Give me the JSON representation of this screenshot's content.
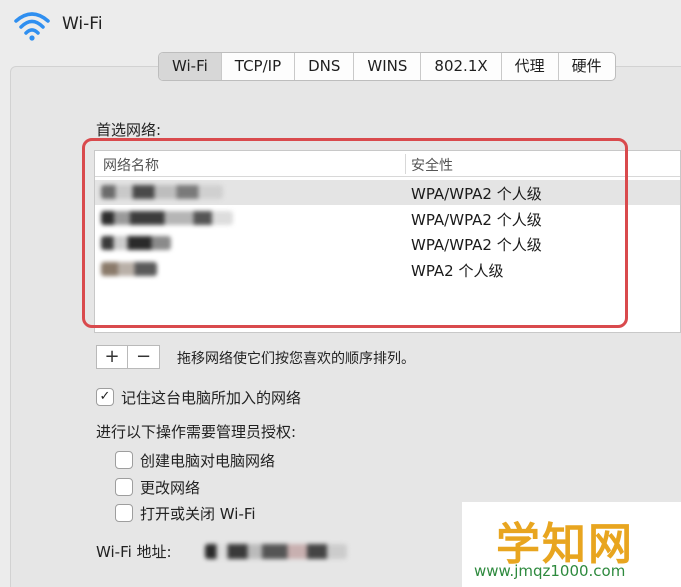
{
  "header": {
    "title": "Wi-Fi",
    "icon": "wifi-icon"
  },
  "tabs": [
    {
      "label": "Wi-Fi",
      "active": true
    },
    {
      "label": "TCP/IP",
      "active": false
    },
    {
      "label": "DNS",
      "active": false
    },
    {
      "label": "WINS",
      "active": false
    },
    {
      "label": "802.1X",
      "active": false
    },
    {
      "label": "代理",
      "active": false
    },
    {
      "label": "硬件",
      "active": false
    }
  ],
  "preferred": {
    "label": "首选网络:",
    "columns": {
      "name": "网络名称",
      "security": "安全性"
    },
    "rows": [
      {
        "security": "WPA/WPA2 个人级",
        "selected": true
      },
      {
        "security": "WPA/WPA2 个人级",
        "selected": false
      },
      {
        "security": "WPA/WPA2 个人级",
        "selected": false
      },
      {
        "security": "WPA2 个人级",
        "selected": false
      }
    ]
  },
  "list_controls": {
    "add": "+",
    "remove": "−",
    "hint": "拖移网络使它们按您喜欢的顺序排列。"
  },
  "remember": {
    "label": "记住这台电脑所加入的网络",
    "checked": true,
    "check_mark": "✓"
  },
  "admin": {
    "label": "进行以下操作需要管理员授权:",
    "options": [
      {
        "label": "创建电脑对电脑网络",
        "checked": false
      },
      {
        "label": "更改网络",
        "checked": false
      },
      {
        "label": "打开或关闭 Wi-Fi",
        "checked": false
      }
    ]
  },
  "wifi_address": {
    "label": "Wi-Fi 地址:"
  },
  "watermark": {
    "title": "学知网",
    "url": "www.jmqz1000.com"
  },
  "colors": {
    "highlight": "#d94a4d",
    "wifi_icon": "#2f8ff0",
    "watermark_gold": "#e8a51f",
    "watermark_green": "#2e8a3e"
  }
}
